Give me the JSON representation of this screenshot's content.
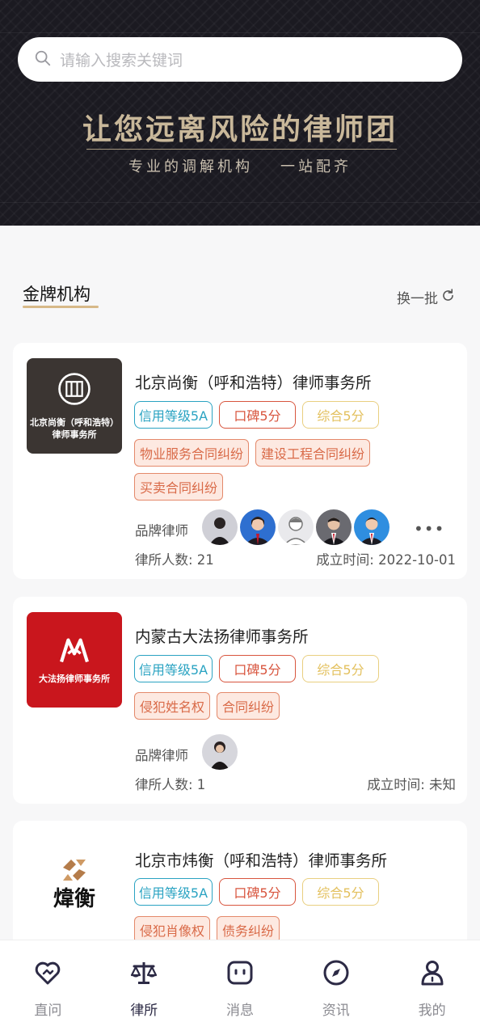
{
  "search": {
    "placeholder": "请输入搜索关键词"
  },
  "banner": {
    "slogan": "让您远离风险的律师团",
    "sub_left": "专业的调解机构",
    "sub_right": "一站配齐"
  },
  "section": {
    "title": "金牌机构",
    "refresh_label": "换一批"
  },
  "firms": [
    {
      "name": "北京尚衡（呼和浩特）律师事务所",
      "logo_caption_1": "北京尚衡（呼和浩特）",
      "logo_caption_2": "律师事务所",
      "badges": [
        "信用等级5A",
        "口碑5分",
        "综合5分"
      ],
      "tags": [
        "物业服务合同纠纷",
        "建设工程合同纠纷",
        "买卖合同纠纷"
      ],
      "lawyers_label": "品牌律师",
      "more": "•••",
      "count_text": "律所人数: 21",
      "founded_text": "成立时间: 2022-10-01"
    },
    {
      "name": "内蒙古大法扬律师事务所",
      "logo_caption_1": "大法扬律师事务所",
      "badges": [
        "信用等级5A",
        "口碑5分",
        "综合5分"
      ],
      "tags": [
        "侵犯姓名权",
        "合同纠纷"
      ],
      "lawyers_label": "品牌律师",
      "count_text": "律所人数: 1",
      "founded_text": "成立时间: 未知"
    },
    {
      "name": "北京市炜衡（呼和浩特）律师事务所",
      "logo_caption_1": "煒衡",
      "badges": [
        "信用等级5A",
        "口碑5分",
        "综合5分"
      ],
      "tags": [
        "侵犯肖像权",
        "债务纠纷"
      ]
    }
  ],
  "tabbar": [
    {
      "label": "直问",
      "icon": "heart-chat-icon"
    },
    {
      "label": "律所",
      "icon": "scales-icon"
    },
    {
      "label": "消息",
      "icon": "message-icon"
    },
    {
      "label": "资讯",
      "icon": "compass-icon"
    },
    {
      "label": "我的",
      "icon": "person-icon"
    }
  ],
  "colors": {
    "accent": "#2c2a45",
    "credit": "#2aa3c2",
    "reputation": "#d8553e",
    "overall": "#e3c05d",
    "tag_bg": "#fde9e1"
  }
}
